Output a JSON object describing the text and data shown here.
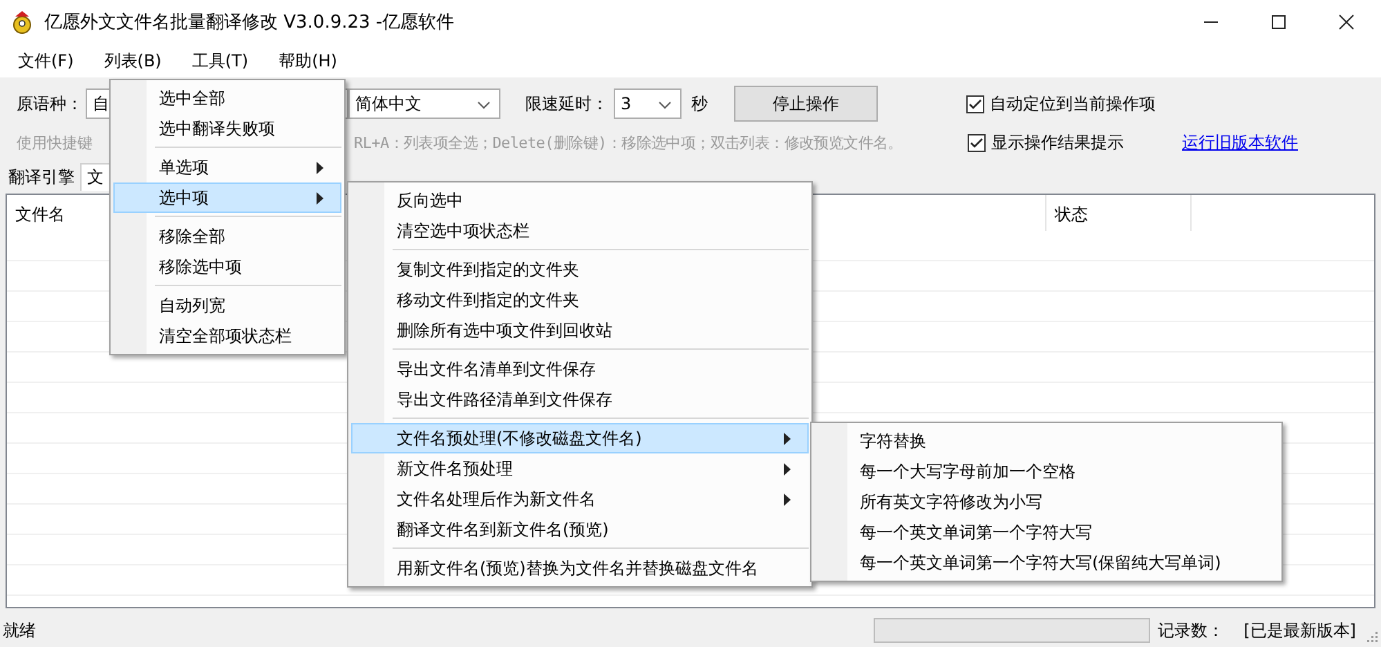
{
  "window": {
    "title": "亿愿外文文件名批量翻译修改 V3.0.9.23 -亿愿软件"
  },
  "menu_bar": [
    "文件(F)",
    "列表(B)",
    "工具(T)",
    "帮助(H)"
  ],
  "toolbar": {
    "source_label": "原语种：",
    "source_value": "自",
    "target_value": "简体中文",
    "delay_label": "限速延时：",
    "delay_value": "3",
    "delay_unit": "秒",
    "stop_button": "停止操作",
    "hint_parts": [
      "使用快捷键",
      "RL+A：列表项全选；Delete(删除键)：移除选中项；双击列表：修改预览文件名。"
    ],
    "checkboxes": [
      {
        "label": "自动定位到当前操作项",
        "checked": true
      },
      {
        "label": "显示操作结果提示",
        "checked": true
      }
    ],
    "link": "运行旧版本软件"
  },
  "tabs": [
    {
      "label": "翻译引擎",
      "selected": false
    },
    {
      "label": "文",
      "selected": true
    }
  ],
  "table": {
    "columns": [
      "文件名",
      "状态"
    ]
  },
  "list_menu": [
    {
      "kind": "item",
      "label": "选中全部",
      "submenu": false,
      "highlighted": false
    },
    {
      "kind": "item",
      "label": "选中翻译失败项",
      "submenu": false,
      "highlighted": false
    },
    {
      "kind": "separator"
    },
    {
      "kind": "item",
      "label": "单选项",
      "submenu": true,
      "highlighted": false
    },
    {
      "kind": "item",
      "label": "选中项",
      "submenu": true,
      "highlighted": true
    },
    {
      "kind": "separator"
    },
    {
      "kind": "item",
      "label": "移除全部",
      "submenu": false,
      "highlighted": false
    },
    {
      "kind": "item",
      "label": "移除选中项",
      "submenu": false,
      "highlighted": false
    },
    {
      "kind": "separator"
    },
    {
      "kind": "item",
      "label": "自动列宽",
      "submenu": false,
      "highlighted": false
    },
    {
      "kind": "item",
      "label": "清空全部项状态栏",
      "submenu": false,
      "highlighted": false
    }
  ],
  "selection_menu": [
    {
      "kind": "item",
      "label": "反向选中",
      "submenu": false,
      "highlighted": false
    },
    {
      "kind": "item",
      "label": "清空选中项状态栏",
      "submenu": false,
      "highlighted": false
    },
    {
      "kind": "separator"
    },
    {
      "kind": "item",
      "label": "复制文件到指定的文件夹",
      "submenu": false,
      "highlighted": false
    },
    {
      "kind": "item",
      "label": "移动文件到指定的文件夹",
      "submenu": false,
      "highlighted": false
    },
    {
      "kind": "item",
      "label": "删除所有选中项文件到回收站",
      "submenu": false,
      "highlighted": false
    },
    {
      "kind": "separator"
    },
    {
      "kind": "item",
      "label": "导出文件名清单到文件保存",
      "submenu": false,
      "highlighted": false
    },
    {
      "kind": "item",
      "label": "导出文件路径清单到文件保存",
      "submenu": false,
      "highlighted": false
    },
    {
      "kind": "separator"
    },
    {
      "kind": "item",
      "label": "文件名预处理(不修改磁盘文件名)",
      "submenu": true,
      "highlighted": true
    },
    {
      "kind": "item",
      "label": "新文件名预处理",
      "submenu": true,
      "highlighted": false
    },
    {
      "kind": "item",
      "label": "文件名处理后作为新文件名",
      "submenu": true,
      "highlighted": false
    },
    {
      "kind": "item",
      "label": "翻译文件名到新文件名(预览)",
      "submenu": false,
      "highlighted": false
    },
    {
      "kind": "separator"
    },
    {
      "kind": "item",
      "label": "用新文件名(预览)替换为文件名并替换磁盘文件名",
      "submenu": false,
      "highlighted": false
    }
  ],
  "preprocess_menu": [
    {
      "kind": "item",
      "label": "字符替换",
      "submenu": false,
      "highlighted": false
    },
    {
      "kind": "item",
      "label": "每一个大写字母前加一个空格",
      "submenu": false,
      "highlighted": false
    },
    {
      "kind": "item",
      "label": "所有英文字符修改为小写",
      "submenu": false,
      "highlighted": false
    },
    {
      "kind": "item",
      "label": "每一个英文单词第一个字符大写",
      "submenu": false,
      "highlighted": false
    },
    {
      "kind": "item",
      "label": "每一个英文单词第一个字符大写(保留纯大写单词)",
      "submenu": false,
      "highlighted": false
    }
  ],
  "status_bar": {
    "text": "就绪",
    "progress": {
      "level": 0
    },
    "records_label": "记录数：",
    "version": "[已是最新版本]"
  }
}
